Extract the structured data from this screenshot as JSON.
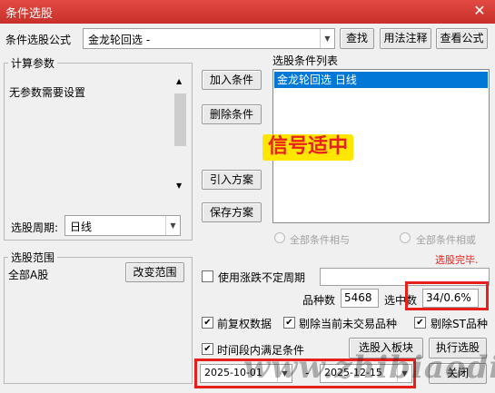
{
  "window": {
    "title": "条件选股",
    "close_glyph": "✕"
  },
  "top": {
    "formula_label": "条件选股公式",
    "formula_value": "金龙轮回选  -",
    "find_button": "查找",
    "usage_button": "用法注释",
    "view_button": "查看公式"
  },
  "params": {
    "group_title": "计算参数",
    "no_params_text": "无参数需要设置",
    "period_label": "选股周期:",
    "period_value": "日线"
  },
  "condition_list": {
    "title": "选股条件列表",
    "items": [
      "金龙轮回选  日线"
    ],
    "selected_index": 0
  },
  "buttons": {
    "add_condition": "加入条件",
    "delete_condition": "删除条件",
    "import_plan": "引入方案",
    "save_plan": "保存方案",
    "change_range": "改变范围",
    "to_board": "选股入板块",
    "execute": "执行选股",
    "close": "关闭"
  },
  "logic": {
    "and_label": "全部条件相与",
    "or_label": "全部条件相或",
    "and_selected": true
  },
  "status": {
    "done_text": "选股完毕."
  },
  "range": {
    "group_title": "选股范围",
    "value": "全部A股"
  },
  "options": {
    "variable_period_label": "使用涨跌不定周期",
    "variable_period_checked": false,
    "forward_adjust_label": "前复权数据",
    "forward_adjust_checked": true,
    "exclude_untraded_label": "剔除当前未交易品种",
    "exclude_untraded_checked": true,
    "exclude_st_label": "剔除ST品种",
    "exclude_st_checked": true,
    "time_range_label": "时间段内满足条件",
    "time_range_checked": true
  },
  "stats": {
    "count_label": "品种数",
    "count_value": "5468",
    "selected_label": "选中数",
    "selected_value": "34/0.6%"
  },
  "dates": {
    "start": "2025-10-01",
    "separator": "-",
    "end": "2025-12-15"
  },
  "overlay": {
    "signal_text": "信号适中",
    "watermark": "www.zhibiaodi.com"
  },
  "colors": {
    "titlebar": "#d63a33",
    "selection": "#0078d7",
    "highlight_border": "#e8201c",
    "status_red": "#e8201c"
  }
}
